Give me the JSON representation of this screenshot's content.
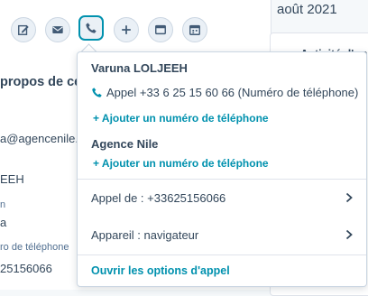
{
  "left_panel": {
    "action_icons": [
      "note-icon",
      "email-icon",
      "phone-icon",
      "add-icon",
      "window-icon",
      "calendar-icon"
    ],
    "about_title": "propos de ce co",
    "email_fragment": "a@agencenile.c",
    "name_fragment": "EEH",
    "label_fragment": "n",
    "company_fragment": "a",
    "phone_label": "ro de téléphone",
    "phone_fragment": "25156066"
  },
  "right_panel": {
    "month": "août 2021",
    "activity_title": "Activité d'un"
  },
  "popover": {
    "contact_name": "Varuna LOLJEEH",
    "call_text": "Appel +33 6 25 15 60 66 (Numéro de téléphone)",
    "add_phone_contact": "+ Ajouter un numéro de téléphone",
    "company_name": "Agence Nile",
    "add_phone_company": "+ Ajouter un numéro de téléphone",
    "call_from": "Appel de : +33625156066",
    "device": "Appareil : navigateur",
    "options_link": "Ouvrir les options d'appel"
  },
  "colors": {
    "accent": "#0091ae",
    "text": "#33475b",
    "border": "#cbd6e2",
    "button_bg": "#eaf0f6"
  }
}
